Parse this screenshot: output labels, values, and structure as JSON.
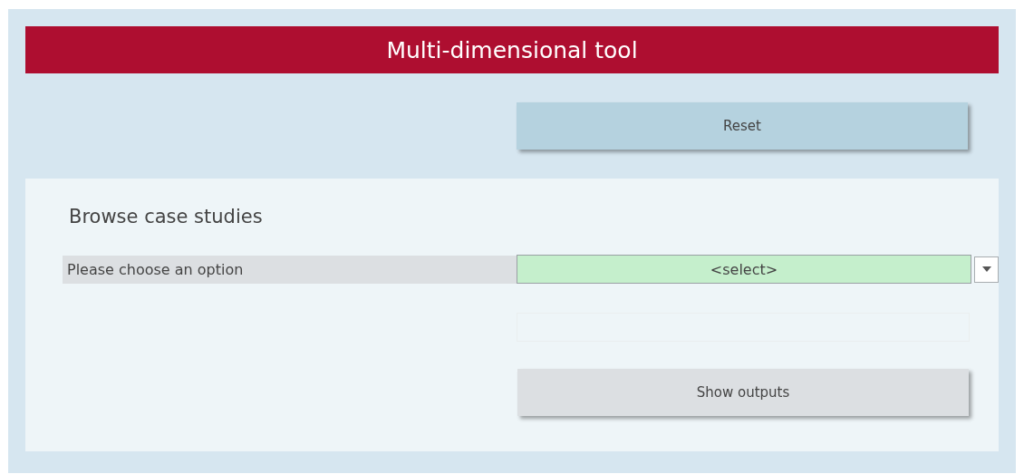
{
  "title": "Multi-dimensional tool",
  "reset_button": "Reset",
  "case_studies": {
    "heading": "Browse case studies",
    "option_label": "Please choose an option",
    "select": {
      "value": "<select>"
    },
    "show_button": "Show outputs"
  }
}
